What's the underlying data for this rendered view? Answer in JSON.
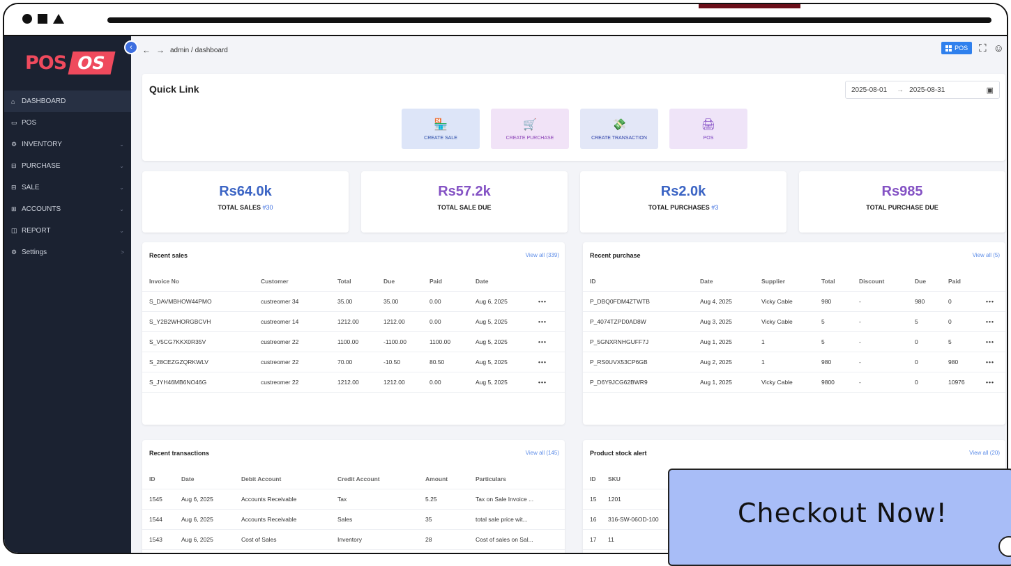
{
  "window": {
    "title": ""
  },
  "sidebar": {
    "logo": {
      "pos": "POS",
      "os": "OS"
    },
    "items": [
      {
        "icon": "⌂",
        "label": "DASHBOARD",
        "chevron": ""
      },
      {
        "icon": "▭",
        "label": "POS",
        "chevron": ""
      },
      {
        "icon": "⚙",
        "label": "INVENTORY",
        "chevron": "⌄"
      },
      {
        "icon": "⊟",
        "label": "PURCHASE",
        "chevron": "⌄"
      },
      {
        "icon": "⊟",
        "label": "SALE",
        "chevron": "⌄"
      },
      {
        "icon": "⊞",
        "label": "ACCOUNTS",
        "chevron": "⌄"
      },
      {
        "icon": "◫",
        "label": "REPORT",
        "chevron": "⌄"
      },
      {
        "icon": "⚙",
        "label": "Settings",
        "chevron": ">"
      }
    ]
  },
  "header": {
    "back": "←",
    "forward": "→",
    "breadcrumb": "admin / dashboard",
    "pos_button": "POS",
    "fullscreen_icon": "⛶",
    "user_icon": "☺"
  },
  "quick_link": {
    "title": "Quick Link",
    "date_from": "2025-08-01",
    "date_sep": "→",
    "date_to": "2025-08-31",
    "calendar_icon": "▣",
    "buttons": [
      {
        "icon": "🏪",
        "label": "CREATE SALE"
      },
      {
        "icon": "🛒",
        "label": "CREATE PURCHASE"
      },
      {
        "icon": "💸",
        "label": "CREATE TRANSACTION"
      },
      {
        "icon": "🖨",
        "label": "POS"
      }
    ]
  },
  "stats": [
    {
      "value": "Rs64.0k",
      "label": "TOTAL SALES",
      "count": "#30"
    },
    {
      "value": "Rs57.2k",
      "label": "TOTAL SALE DUE",
      "count": ""
    },
    {
      "value": "Rs2.0k",
      "label": "TOTAL PURCHASES",
      "count": "#3"
    },
    {
      "value": "Rs985",
      "label": "TOTAL PURCHASE DUE",
      "count": ""
    }
  ],
  "recent_sales": {
    "title": "Recent sales",
    "view_all": "View all (339)",
    "columns": [
      "Invoice No",
      "Customer",
      "Total",
      "Due",
      "Paid",
      "Date",
      ""
    ],
    "rows": [
      [
        "S_DAVMBHOW44PMO",
        "custreomer 34",
        "35.00",
        "35.00",
        "0.00",
        "Aug 6, 2025",
        "•••"
      ],
      [
        "S_Y2B2WHORGBCVH",
        "custreomer 14",
        "1212.00",
        "1212.00",
        "0.00",
        "Aug 5, 2025",
        "•••"
      ],
      [
        "S_V5CG7KKX0R35V",
        "custreomer 22",
        "1100.00",
        "-1100.00",
        "1100.00",
        "Aug 5, 2025",
        "•••"
      ],
      [
        "S_28CEZGZQRKWLV",
        "custreomer 22",
        "70.00",
        "-10.50",
        "80.50",
        "Aug 5, 2025",
        "•••"
      ],
      [
        "S_JYH46MB6NO46G",
        "custreomer 22",
        "1212.00",
        "1212.00",
        "0.00",
        "Aug 5, 2025",
        "•••"
      ]
    ]
  },
  "recent_purchase": {
    "title": "Recent purchase",
    "view_all": "View all (5)",
    "columns": [
      "ID",
      "Date",
      "Supplier",
      "Total",
      "Discount",
      "Due",
      "Paid",
      ""
    ],
    "rows": [
      [
        "P_DBQ0FDM4ZTWTB",
        "Aug 4, 2025",
        "Vicky Cable",
        "980",
        "-",
        "980",
        "0",
        "•••"
      ],
      [
        "P_4074TZPD0AD8W",
        "Aug 3, 2025",
        "Vicky Cable",
        "5",
        "-",
        "5",
        "0",
        "•••"
      ],
      [
        "P_5GNXRNHGUFF7J",
        "Aug 1, 2025",
        "1",
        "5",
        "-",
        "0",
        "5",
        "•••"
      ],
      [
        "P_RS0UVX53CP6GB",
        "Aug 2, 2025",
        "1",
        "980",
        "-",
        "0",
        "980",
        "•••"
      ],
      [
        "P_D6Y9JCG62BWR9",
        "Aug 1, 2025",
        "Vicky Cable",
        "9800",
        "-",
        "0",
        "10976",
        "•••"
      ]
    ]
  },
  "recent_transactions": {
    "title": "Recent transactions",
    "view_all": "View all (145)",
    "columns": [
      "ID",
      "Date",
      "Debit Account",
      "Credit Account",
      "Amount",
      "Particulars"
    ],
    "rows": [
      [
        "1545",
        "Aug 6, 2025",
        "Accounts Receivable",
        "Tax",
        "5.25",
        "Tax on Sale Invoice ..."
      ],
      [
        "1544",
        "Aug 6, 2025",
        "Accounts Receivable",
        "Sales",
        "35",
        "total sale price wit..."
      ],
      [
        "1543",
        "Aug 6, 2025",
        "Cost of Sales",
        "Inventory",
        "28",
        "Cost of sales on Sal..."
      ]
    ]
  },
  "stock_alert": {
    "title": "Product stock alert",
    "view_all": "View all (20)",
    "columns": [
      "ID",
      "SKU"
    ],
    "rows": [
      [
        "15",
        "1201"
      ],
      [
        "16",
        "316-SW-06OD-100"
      ],
      [
        "17",
        "11"
      ]
    ]
  },
  "checkout": {
    "label": "Checkout Now!"
  }
}
